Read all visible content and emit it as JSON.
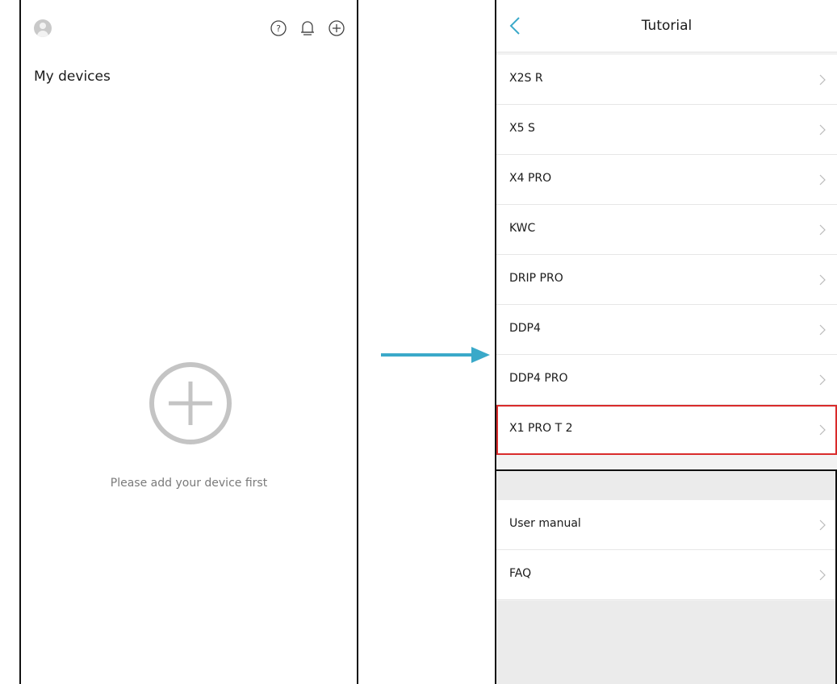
{
  "left": {
    "title": "My devices",
    "empty_message": "Please add your device first",
    "icons": [
      "avatar-icon",
      "help-icon",
      "bell-icon",
      "add-icon"
    ]
  },
  "right": {
    "nav_title": "Tutorial",
    "tutorial_items": [
      {
        "label": "X2S R"
      },
      {
        "label": "X5 S"
      },
      {
        "label": "X4 PRO"
      },
      {
        "label": "KWC"
      },
      {
        "label": "DRIP PRO"
      },
      {
        "label": "DDP4"
      },
      {
        "label": "DDP4 PRO"
      },
      {
        "label": "X1 PRO T 2",
        "highlighted": true
      }
    ],
    "extra_items": [
      {
        "label": "User manual"
      },
      {
        "label": "FAQ"
      }
    ]
  },
  "colors": {
    "accent": "#3aa9c9",
    "highlight": "#d92b2b",
    "icon_gray": "#c4c4c4"
  }
}
